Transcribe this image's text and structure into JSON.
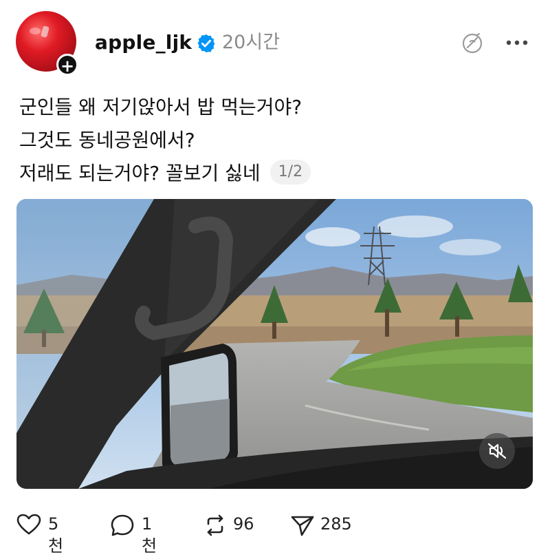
{
  "post": {
    "username": "apple_ljk",
    "verified": true,
    "time": "20시간",
    "text_lines": [
      "군인들 왜 저기앉아서 밥 먹는거야?",
      "그것도 동네공원에서?",
      "저래도 되는거야? 꼴보기 싫네"
    ],
    "page_indicator": "1/2"
  },
  "media": {
    "type": "video",
    "muted": true,
    "description_icon": "muted-speaker-icon"
  },
  "actions": {
    "like_count": "5천",
    "comment_count": "1천",
    "repost_count": "96",
    "share_count": "285"
  },
  "icons": {
    "avatar": "red-apple-avatar",
    "follow": "plus-icon",
    "verified": "verified-badge-icon",
    "translate": "translate-icon",
    "more": "more-icon",
    "like": "heart-icon",
    "comment": "comment-bubble-icon",
    "repost": "repost-icon",
    "share": "send-icon"
  },
  "colors": {
    "verified_blue": "#0095f6",
    "text": "#111111",
    "muted_text": "#8a8a8a"
  }
}
